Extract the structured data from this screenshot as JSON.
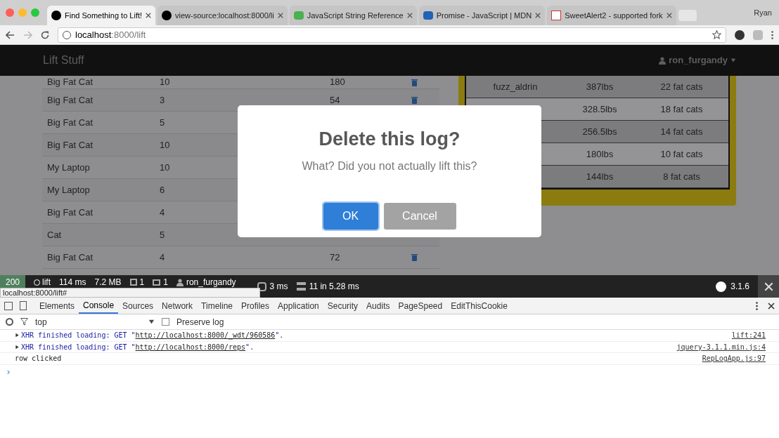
{
  "browser": {
    "tabs": [
      {
        "title": "Find Something to Lift!",
        "selected": true,
        "kind": "symfony"
      },
      {
        "title": "view-source:localhost:8000/li",
        "selected": false,
        "kind": "symfony"
      },
      {
        "title": "JavaScript String Reference",
        "selected": false,
        "kind": "w3"
      },
      {
        "title": "Promise - JavaScript | MDN",
        "selected": false,
        "kind": "mdn"
      },
      {
        "title": "SweetAlert2 - supported fork",
        "selected": false,
        "kind": "sa"
      }
    ],
    "profile": "Ryan",
    "url_host": "localhost",
    "url_rest": ":8000/lift"
  },
  "navbar": {
    "brand": "Lift Stuff",
    "user": "ron_furgandy"
  },
  "rep_table": {
    "rows": [
      {
        "item": "Big Fat Cat",
        "reps": "10",
        "weight": "180"
      },
      {
        "item": "Big Fat Cat",
        "reps": "3",
        "weight": "54"
      },
      {
        "item": "Big Fat Cat",
        "reps": "5"
      },
      {
        "item": "Big Fat Cat",
        "reps": "10"
      },
      {
        "item": "My Laptop",
        "reps": "10"
      },
      {
        "item": "My Laptop",
        "reps": "6"
      },
      {
        "item": "Big Fat Cat",
        "reps": "4"
      },
      {
        "item": "Cat",
        "reps": "5"
      },
      {
        "item": "Big Fat Cat",
        "reps": "4",
        "weight": "72"
      }
    ]
  },
  "leaderboard": {
    "rows": [
      {
        "name": "fuzz_aldrin",
        "weight": "387lbs",
        "cats": "22 fat cats"
      },
      {
        "weight": "328.5lbs",
        "cats": "18 fat cats"
      },
      {
        "weight": "256.5lbs",
        "cats": "14 fat cats"
      },
      {
        "weight": "180lbs",
        "cats": "10 fat cats"
      },
      {
        "weight": "144lbs",
        "cats": "8 fat cats"
      }
    ]
  },
  "dialog": {
    "title": "Delete this log?",
    "text": "What? Did you not actually lift this?",
    "confirm": "OK",
    "cancel": "Cancel"
  },
  "debug_toolbar": {
    "status": "200",
    "route": "lift",
    "time": "114 ms",
    "memory": "7.2 MB",
    "forms": "1",
    "logs": "1",
    "user": "ron_furgandy",
    "render": "3 ms",
    "queries": "11",
    "queries_time": "in 5.28 ms",
    "version": "3.1.6"
  },
  "status_url": "localhost:8000/lift#",
  "devtools": {
    "tabs": [
      {
        "label": "Elements",
        "selected": false
      },
      {
        "label": "Console",
        "selected": true
      },
      {
        "label": "Sources",
        "selected": false
      },
      {
        "label": "Network",
        "selected": false
      },
      {
        "label": "Timeline",
        "selected": false
      },
      {
        "label": "Profiles",
        "selected": false
      },
      {
        "label": "Application",
        "selected": false
      },
      {
        "label": "Security",
        "selected": false
      },
      {
        "label": "Audits",
        "selected": false
      },
      {
        "label": "PageSpeed",
        "selected": false
      },
      {
        "label": "EditThisCookie",
        "selected": false
      }
    ],
    "context": "top",
    "preserve_log": {
      "label": "Preserve log",
      "checked": false
    },
    "messages": [
      {
        "kind": "xhr",
        "prefix": "XHR finished loading: GET \"",
        "url": "http://localhost:8000/_wdt/960586",
        "suffix": "\".",
        "source": "lift:241"
      },
      {
        "kind": "xhr",
        "prefix": "XHR finished loading: GET \"",
        "url": "http://localhost:8000/reps",
        "suffix": "\".",
        "source": "jquery-3.1.1.min.js:4"
      },
      {
        "kind": "log",
        "text": "row clicked",
        "source": "RepLogApp.js:97"
      }
    ],
    "prompt": "›"
  }
}
